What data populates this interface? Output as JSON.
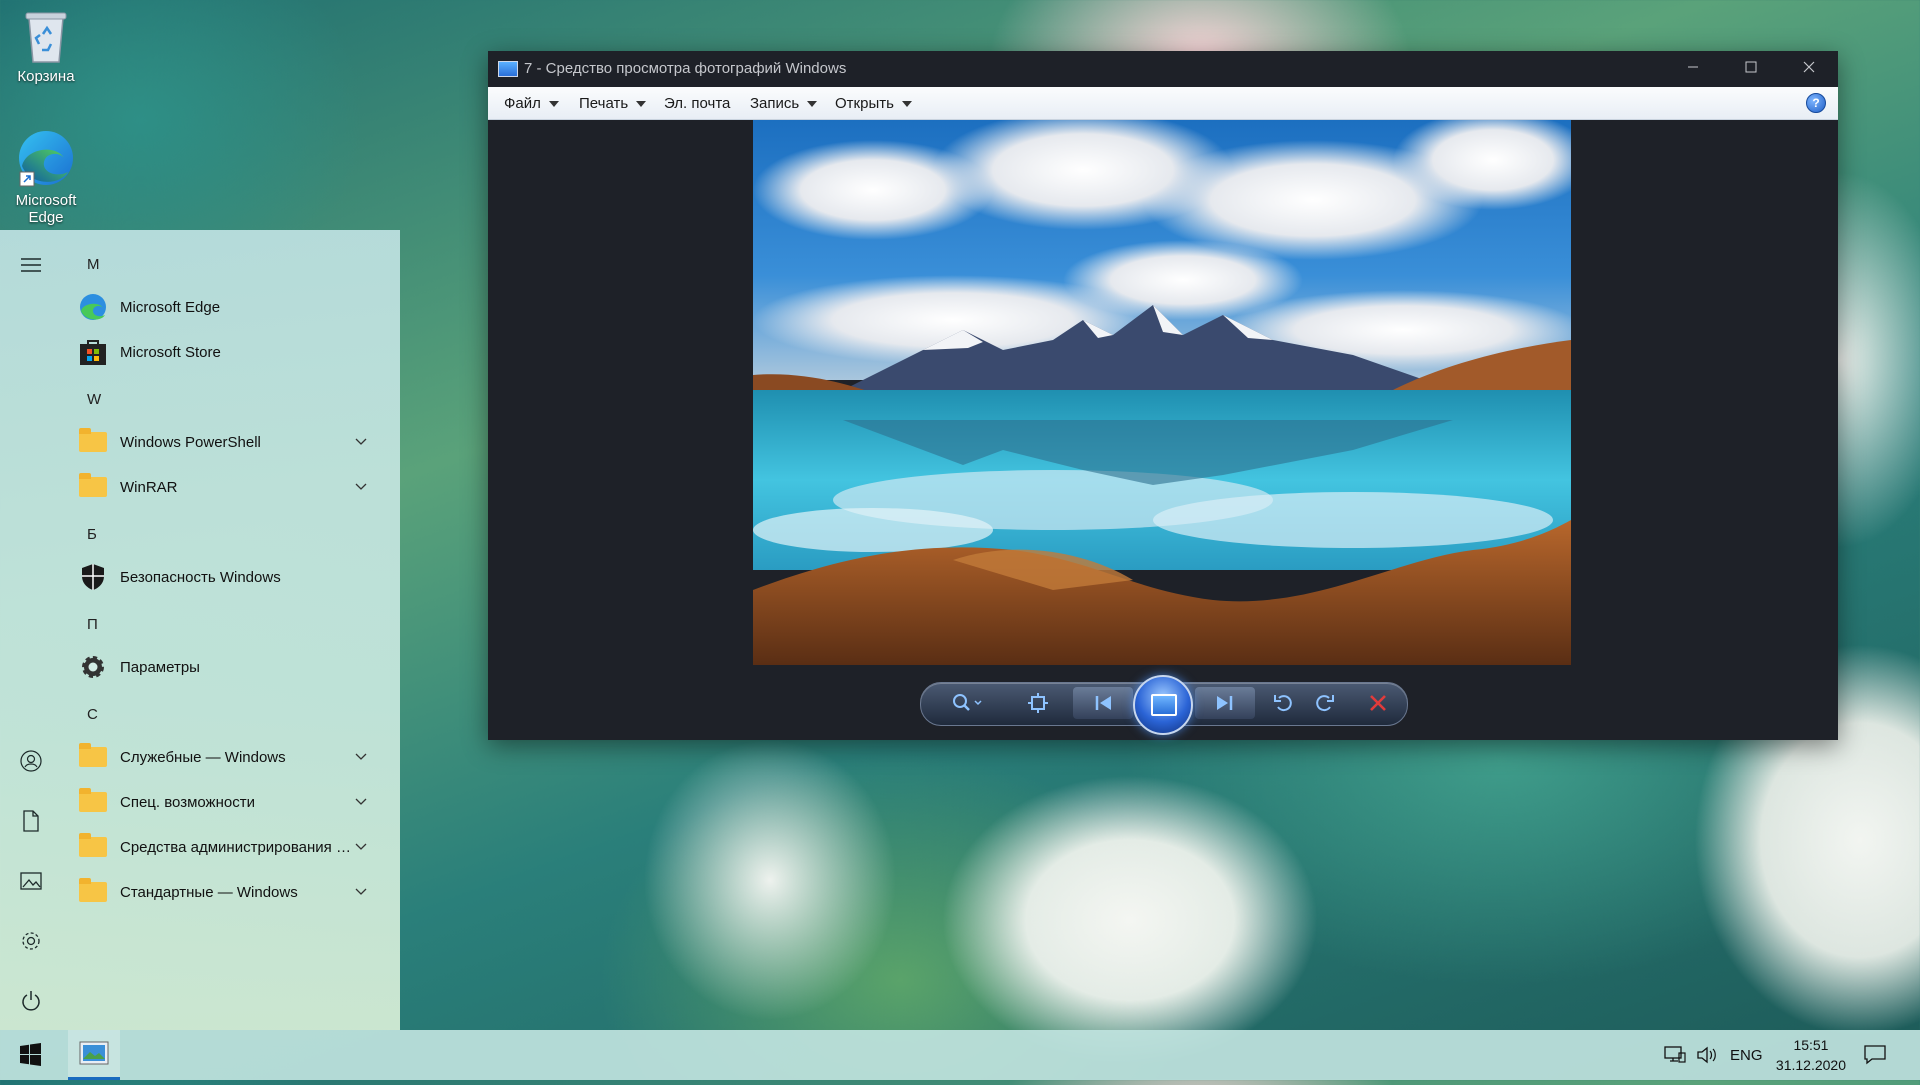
{
  "desktop": {
    "icons": [
      {
        "label": "Корзина"
      },
      {
        "label": "Microsoft Edge"
      }
    ]
  },
  "start_menu": {
    "letters": [
      "M",
      "W",
      "Б",
      "П",
      "С"
    ],
    "apps": [
      {
        "label": "Microsoft Edge",
        "icon": "edge-icon"
      },
      {
        "label": "Microsoft Store",
        "icon": "store-icon"
      },
      {
        "label": "Windows PowerShell",
        "icon": "folder-icon",
        "expandable": true
      },
      {
        "label": "WinRAR",
        "icon": "folder-icon",
        "expandable": true
      },
      {
        "label": "Безопасность Windows",
        "icon": "shield-icon"
      },
      {
        "label": "Параметры",
        "icon": "gear-icon"
      },
      {
        "label": "Служебные — Windows",
        "icon": "folder-icon",
        "expandable": true
      },
      {
        "label": "Спец. возможности",
        "icon": "folder-icon",
        "expandable": true
      },
      {
        "label": "Средства администрирования Windows",
        "icon": "folder-icon",
        "expandable": true
      },
      {
        "label": "Стандартные — Windows",
        "icon": "folder-icon",
        "expandable": true
      }
    ],
    "rail": [
      "hamburger-icon",
      "user-icon",
      "document-icon",
      "pictures-icon",
      "gear-icon",
      "power-icon"
    ]
  },
  "viewer": {
    "title": "7 - Средство просмотра фотографий Windows",
    "menu": [
      {
        "label": "Файл",
        "dropdown": true
      },
      {
        "label": "Печать",
        "dropdown": true
      },
      {
        "label": "Эл. почта",
        "dropdown": false
      },
      {
        "label": "Запись",
        "dropdown": true
      },
      {
        "label": "Открыть",
        "dropdown": true
      }
    ],
    "help_label": "?"
  },
  "taskbar": {
    "lang": "ENG",
    "time": "15:51",
    "date": "31.12.2020"
  },
  "colors": {
    "accent": "#1a6bbf",
    "viewer_bg": "#1e2128"
  }
}
